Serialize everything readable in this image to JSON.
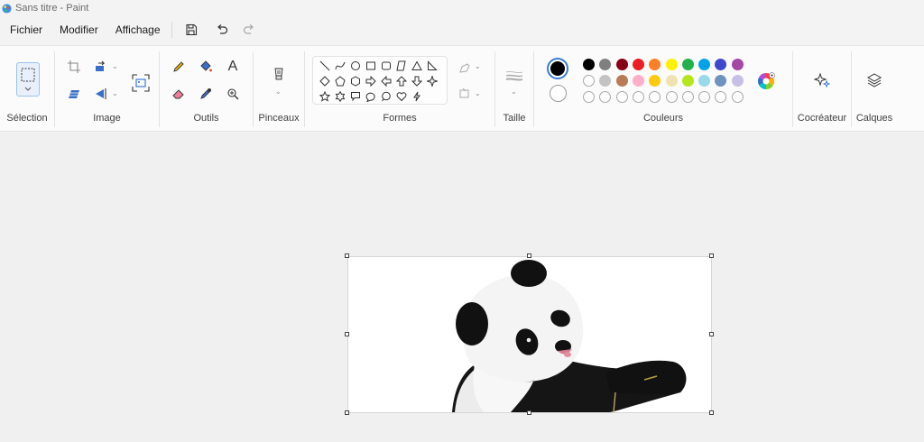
{
  "window": {
    "title": "Sans titre - Paint"
  },
  "menu": {
    "file": "Fichier",
    "edit": "Modifier",
    "view": "Affichage"
  },
  "quick_access": {
    "icons": [
      "save-icon",
      "undo-icon",
      "redo-icon"
    ]
  },
  "ribbon": {
    "groups": {
      "selection": "Sélection",
      "image": "Image",
      "tools": "Outils",
      "brushes": "Pinceaux",
      "shapes": "Formes",
      "size": "Taille",
      "colors": "Couleurs",
      "cocreator": "Cocréateur",
      "layers": "Calques"
    },
    "tools_text_glyph": "A"
  },
  "colors": {
    "primary": "#000000",
    "secondary": "#ffffff",
    "row1": [
      "#000000",
      "#7f7f7f",
      "#880015",
      "#ed1c24",
      "#ff7f27",
      "#fff200",
      "#22b14c",
      "#00a2e8",
      "#3f48cc",
      "#a349a4"
    ],
    "row2": [
      "#ffffff",
      "#c3c3c3",
      "#b97a57",
      "#ffaec9",
      "#ffc90e",
      "#efe4b0",
      "#b5e61d",
      "#99d9ea",
      "#7092be",
      "#c8bfe7"
    ],
    "row3_empty_count": 10
  },
  "canvas": {
    "content": "panda-image"
  }
}
